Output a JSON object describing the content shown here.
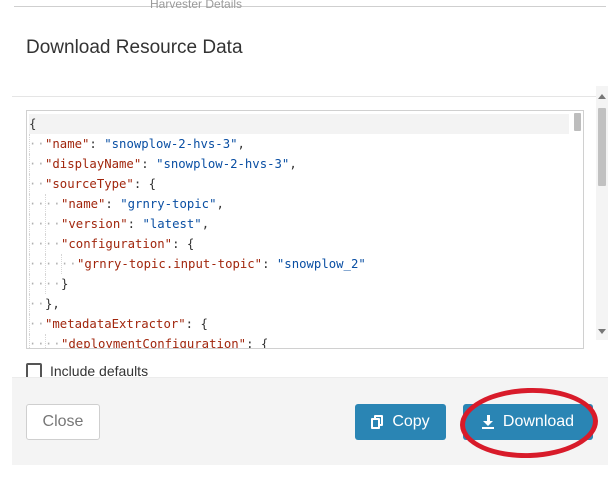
{
  "background": {
    "ghost_text": "Harvester Details"
  },
  "modal": {
    "title": "Download Resource Data",
    "editor": {
      "lines": [
        [
          {
            "t": "p",
            "v": "{"
          }
        ],
        [
          {
            "t": "k",
            "v": "\"name\""
          },
          {
            "t": "p",
            "v": ": "
          },
          {
            "t": "s",
            "v": "\"snowplow-2-hvs-3\""
          },
          {
            "t": "p",
            "v": ","
          }
        ],
        [
          {
            "t": "k",
            "v": "\"displayName\""
          },
          {
            "t": "p",
            "v": ": "
          },
          {
            "t": "s",
            "v": "\"snowplow-2-hvs-3\""
          },
          {
            "t": "p",
            "v": ","
          }
        ],
        [
          {
            "t": "k",
            "v": "\"sourceType\""
          },
          {
            "t": "p",
            "v": ": {"
          }
        ],
        [
          {
            "t": "k",
            "v": "\"name\""
          },
          {
            "t": "p",
            "v": ": "
          },
          {
            "t": "s",
            "v": "\"grnry-topic\""
          },
          {
            "t": "p",
            "v": ","
          }
        ],
        [
          {
            "t": "k",
            "v": "\"version\""
          },
          {
            "t": "p",
            "v": ": "
          },
          {
            "t": "s",
            "v": "\"latest\""
          },
          {
            "t": "p",
            "v": ","
          }
        ],
        [
          {
            "t": "k",
            "v": "\"configuration\""
          },
          {
            "t": "p",
            "v": ": {"
          }
        ],
        [
          {
            "t": "k",
            "v": "\"grnry-topic.input-topic\""
          },
          {
            "t": "p",
            "v": ": "
          },
          {
            "t": "s",
            "v": "\"snowplow_2\""
          }
        ],
        [
          {
            "t": "p",
            "v": "}"
          }
        ],
        [
          {
            "t": "p",
            "v": "},"
          }
        ],
        [
          {
            "t": "k",
            "v": "\"metadataExtractor\""
          },
          {
            "t": "p",
            "v": ": {"
          }
        ],
        [
          {
            "t": "k",
            "v": "\"deploymentConfiguration\""
          },
          {
            "t": "p",
            "v": ": {"
          }
        ]
      ],
      "indent": [
        0,
        1,
        1,
        1,
        2,
        2,
        2,
        3,
        2,
        1,
        1,
        2
      ]
    },
    "include_defaults_label": "Include defaults",
    "include_defaults_checked": false,
    "buttons": {
      "close": "Close",
      "copy": "Copy",
      "download": "Download"
    },
    "colors": {
      "primary": "#2a85b4",
      "annotation": "#d81b2a"
    }
  }
}
